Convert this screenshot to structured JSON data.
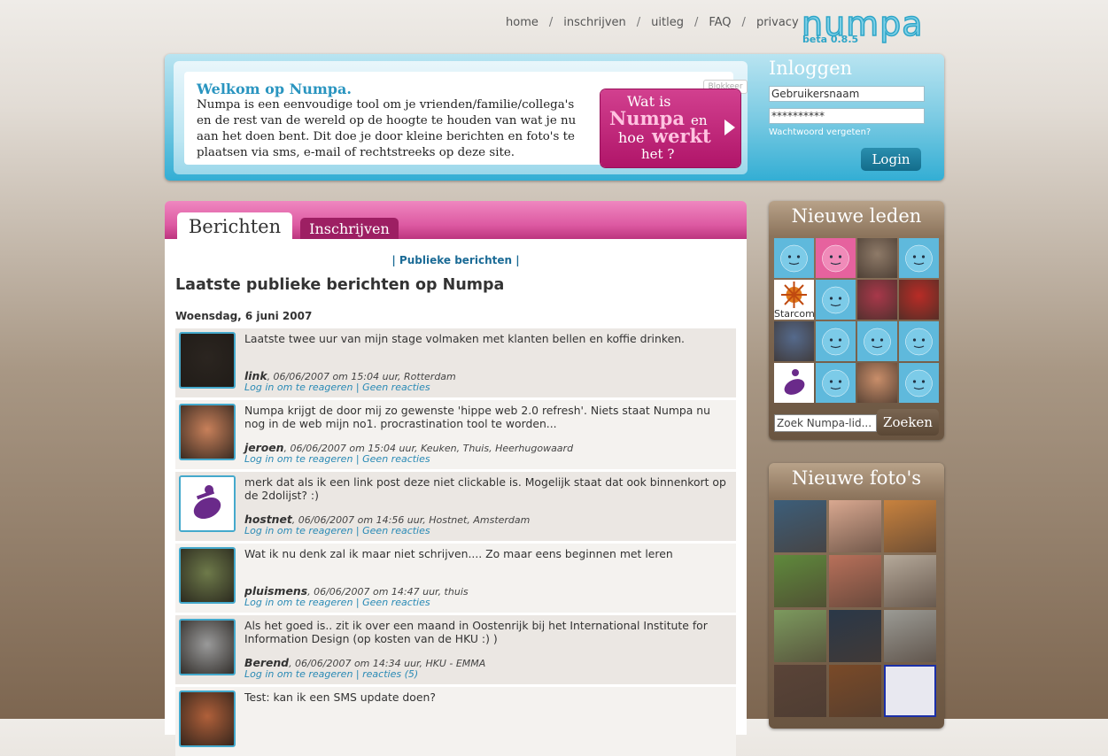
{
  "nav": {
    "items": [
      "home",
      "inschrijven",
      "uitleg",
      "FAQ",
      "privacy"
    ],
    "separator": "/"
  },
  "logo": {
    "word": "numpa",
    "version": "beta 0.8.5"
  },
  "welcome": {
    "title": "Welkom op Numpa.",
    "text": "Numpa is een eenvoudige tool om je vrienden/familie/collega's en de rest van de wereld op de hoogte te houden van wat je nu aan het doen bent. Dit doe je door kleine berichten en foto's te plaatsen via sms, e-mail of rechtstreeks op deze site.",
    "block_label": "Blokkeer",
    "promo": {
      "l1": "Wat is",
      "l2": "Numpa",
      "l2b": "en",
      "l3a": "hoe",
      "l3b": "werkt",
      "l4": "het ?"
    }
  },
  "login": {
    "title": "Inloggen",
    "username_value": "Gebruikersnaam",
    "password_value": "**********",
    "forgot": "Wachtwoord vergeten?",
    "button": "Login"
  },
  "tabs": {
    "active": "Berichten",
    "inactive": "Inschrijven"
  },
  "main": {
    "public_link": "| Publieke berichten |",
    "title": "Laatste publieke berichten op Numpa",
    "date": "Woensdag, 6 juni 2007"
  },
  "posts": [
    {
      "text": "Laatste twee uur van mijn stage volmaken met klanten bellen en koffie drinken.",
      "user": "link",
      "meta": ", 06/06/2007 om 15:04 uur, Rotterdam",
      "login_link": "Log in om te reageren",
      "reactions": "Geen reacties",
      "avatar_color": "#2b2520"
    },
    {
      "text": "Numpa krijgt de door mij zo gewenste 'hippe web 2.0 refresh'. Niets staat Numpa nu nog in de web mijn no1. procrastination tool te worden...",
      "user": "jeroen",
      "meta": ", 06/06/2007 om 15:04 uur, Keuken, Thuis, Heerhugowaard",
      "login_link": "Log in om te reageren",
      "reactions": "Geen reacties",
      "avatar_color": "#c8805a"
    },
    {
      "text": "merk dat als ik een link post deze niet clickable is. Mogelijk staat dat ook binnenkort op de 2dolijst? :)",
      "user": "hostnet",
      "meta": ", 06/06/2007 om 14:56 uur, Hostnet, Amsterdam",
      "login_link": "Log in om te reageren",
      "reactions": "Geen reacties",
      "avatar_color": "#ffffff"
    },
    {
      "text": "Wat ik nu denk zal ik maar niet schrijven.... Zo maar eens beginnen met leren",
      "user": "pluismens",
      "meta": ", 06/06/2007 om 14:47 uur, thuis",
      "login_link": "Log in om te reageren",
      "reactions": "Geen reacties",
      "avatar_color": "#6e7a4a"
    },
    {
      "text": "Als het goed is.. zit ik over een maand in Oostenrijk bij het International Institute for Information Design (op kosten van de HKU :) )",
      "user": "Berend",
      "meta": ", 06/06/2007 om 14:34 uur, HKU - EMMA",
      "login_link": "Log in om te reageren",
      "reactions": "reacties (5)",
      "avatar_color": "#9a9a9a"
    },
    {
      "text": "Test: kan ik een SMS update doen?",
      "user": "",
      "meta": "",
      "login_link": "",
      "reactions": "",
      "avatar_color": "#b0603a"
    }
  ],
  "new_members": {
    "title": "Nieuwe leden",
    "cells": [
      {
        "type": "default-blue"
      },
      {
        "type": "default-pink"
      },
      {
        "type": "photo",
        "color": "#8e7a68"
      },
      {
        "type": "default-blue"
      },
      {
        "type": "starcom",
        "label": "Starcom"
      },
      {
        "type": "default-blue"
      },
      {
        "type": "photo",
        "color": "#a8384a"
      },
      {
        "type": "photo",
        "color": "#b82c26"
      },
      {
        "type": "photo",
        "color": "#556a8c"
      },
      {
        "type": "default-blue"
      },
      {
        "type": "default-blue"
      },
      {
        "type": "default-blue"
      },
      {
        "type": "hostnet"
      },
      {
        "type": "default-blue"
      },
      {
        "type": "photo",
        "color": "#c98e6a"
      },
      {
        "type": "default-blue"
      }
    ],
    "search_placeholder": "Zoek Numpa-lid...",
    "search_button": "Zoeken"
  },
  "new_photos": {
    "title": "Nieuwe foto's",
    "photos": [
      {
        "color": "#3c5e7a"
      },
      {
        "color": "#d9a890"
      },
      {
        "color": "#c8823e"
      },
      {
        "color": "#5f8a3c"
      },
      {
        "color": "#b8705a"
      },
      {
        "color": "#b5a99a"
      },
      {
        "color": "#7c9a5e"
      },
      {
        "color": "#2a3848"
      },
      {
        "color": "#9b9b95"
      },
      {
        "color": "#5a4438"
      },
      {
        "color": "#7a4a28"
      },
      {
        "color": "#e8e8f0",
        "border": "#1b2fa8"
      }
    ]
  }
}
